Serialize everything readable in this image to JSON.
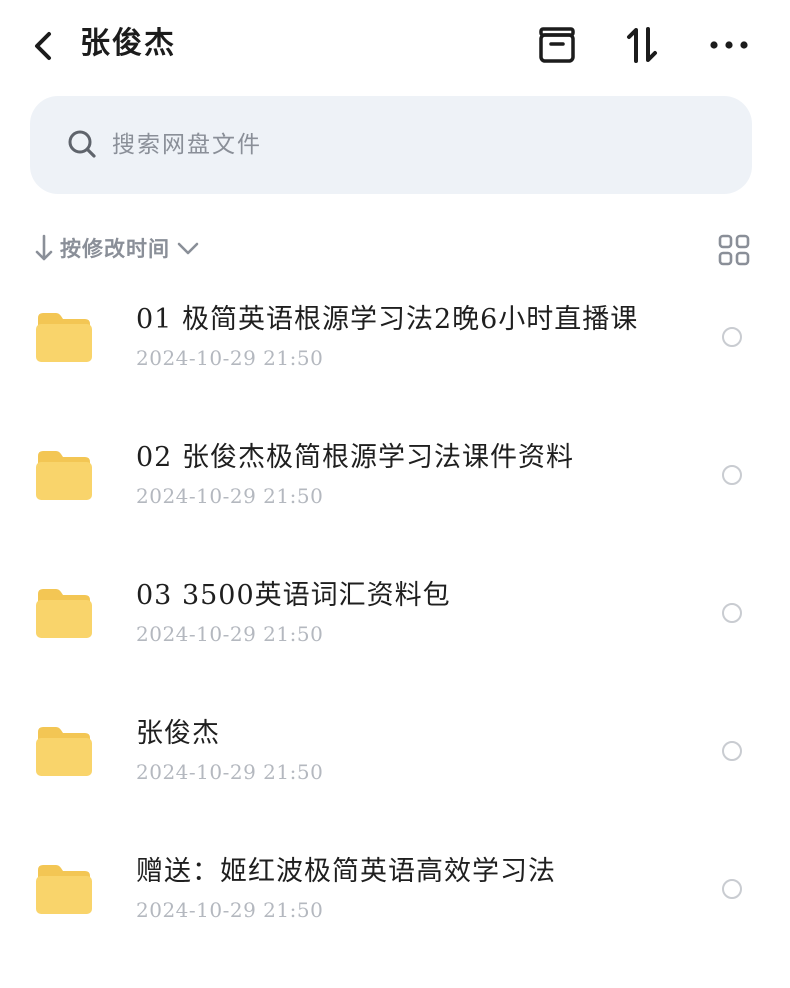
{
  "header": {
    "title": "张俊杰",
    "back_icon": "chevron-left-icon",
    "icons": [
      "archive-box-icon",
      "sort-arrows-icon",
      "more-horizontal-icon"
    ]
  },
  "search": {
    "placeholder": "搜索网盘文件",
    "icon": "search-icon"
  },
  "sort": {
    "label": "按修改时间",
    "direction_icon": "arrow-down-icon",
    "dropdown_icon": "chevron-down-icon",
    "view_toggle_icon": "grid-view-icon"
  },
  "files": [
    {
      "name": "01 极简英语根源学习法2晚6小时直播课",
      "date": "2024-10-29  21:50",
      "type": "folder"
    },
    {
      "name": "02 张俊杰极简根源学习法课件资料",
      "date": "2024-10-29  21:50",
      "type": "folder"
    },
    {
      "name": "03 3500英语词汇资料包",
      "date": "2024-10-29  21:50",
      "type": "folder"
    },
    {
      "name": "张俊杰",
      "date": "2024-10-29  21:50",
      "type": "folder"
    },
    {
      "name": "赠送：姬红波极简英语高效学习法",
      "date": "2024-10-29  21:50",
      "type": "folder"
    }
  ],
  "colors": {
    "folder": "#f9d46b",
    "search_bg": "#eef2f7",
    "muted_text": "#8a8f98",
    "date_text": "#b4b8bf"
  }
}
